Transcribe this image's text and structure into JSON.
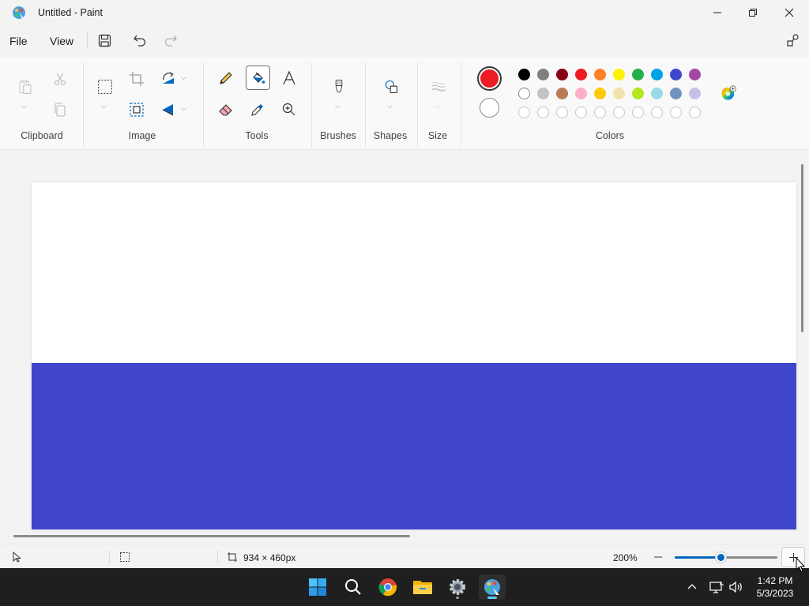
{
  "window": {
    "title": "Untitled - Paint",
    "controls": [
      "minimize",
      "restore",
      "close"
    ]
  },
  "menu": {
    "file": "File",
    "view": "View"
  },
  "ribbon": {
    "groups": {
      "clipboard": "Clipboard",
      "image": "Image",
      "tools": "Tools",
      "brushes": "Brushes",
      "shapes": "Shapes",
      "size": "Size",
      "colors": "Colors"
    },
    "selected_tool": "fill-bucket"
  },
  "colors": {
    "primary": "#ed1c24",
    "secondary": "#ffffff",
    "palette_row1": [
      "#000000",
      "#7f7f7f",
      "#880015",
      "#ed1c24",
      "#ff7f27",
      "#fff200",
      "#22b14c",
      "#00a2e8",
      "#3f48cc",
      "#a349a4"
    ],
    "palette_row2": [
      "#ffffff",
      "#c3c3c3",
      "#b97a57",
      "#ffaec9",
      "#ffc90e",
      "#efe4b0",
      "#b5e61d",
      "#99d9ea",
      "#7092be",
      "#c8bfe7"
    ],
    "palette_row3_empty": 10
  },
  "canvas": {
    "background": "#ffffff",
    "fill_color": "#4046cc"
  },
  "status": {
    "canvas_size": "934 × 460px",
    "zoom_label": "200%",
    "zoom_fraction": 0.45
  },
  "taskbar": {
    "apps": [
      "start-icon",
      "search-icon",
      "chrome-icon",
      "file-explorer-icon",
      "settings-icon",
      "paint-icon"
    ],
    "time": "1:42 PM",
    "date": "5/3/2023"
  }
}
